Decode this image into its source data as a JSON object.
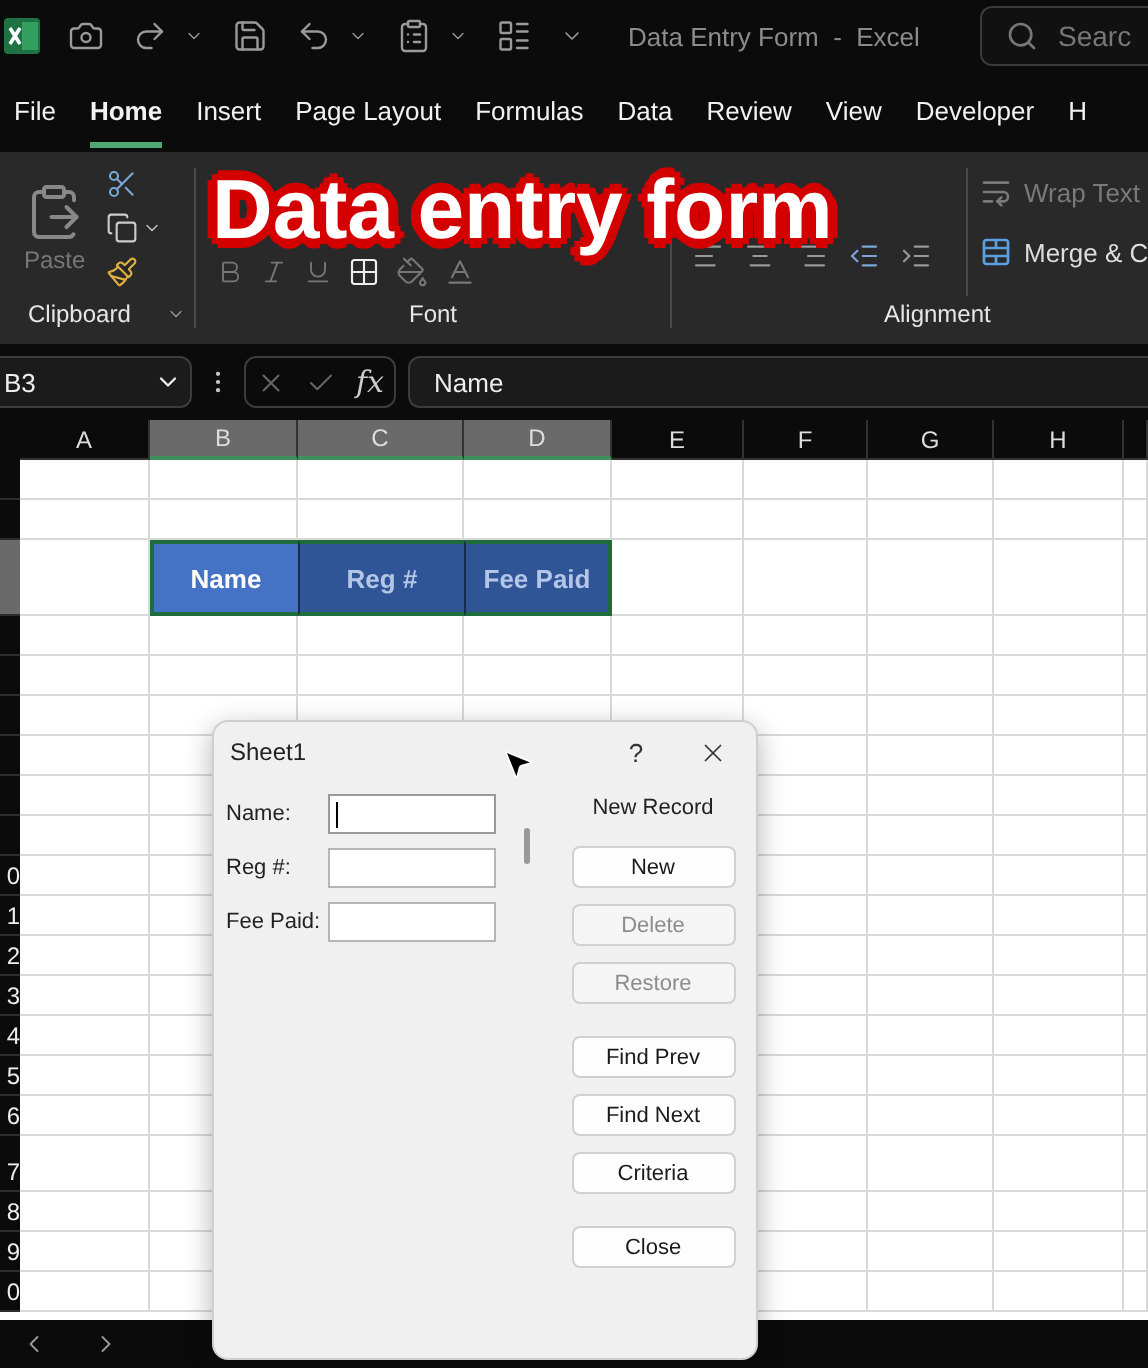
{
  "title_bar": {
    "title": "Data Entry Form  -  Excel",
    "search_placeholder": "Searc"
  },
  "menu_tabs": [
    {
      "label": "File",
      "selected": false
    },
    {
      "label": "Home",
      "selected": true
    },
    {
      "label": "Insert",
      "selected": false
    },
    {
      "label": "Page Layout",
      "selected": false
    },
    {
      "label": "Formulas",
      "selected": false
    },
    {
      "label": "Data",
      "selected": false
    },
    {
      "label": "Review",
      "selected": false
    },
    {
      "label": "View",
      "selected": false
    },
    {
      "label": "Developer",
      "selected": false
    },
    {
      "label": "H",
      "selected": false
    }
  ],
  "ribbon": {
    "paste_label": "Paste",
    "wrap_text": "Wrap Text",
    "merge": "Merge & C",
    "groups": [
      {
        "label": "Clipboard"
      },
      {
        "label": "Font"
      },
      {
        "label": "Alignment"
      }
    ]
  },
  "caption": "Data entry form",
  "formula_bar": {
    "name_box": "B3",
    "fx_label": "fx",
    "formula": "Name"
  },
  "sheet": {
    "columns": [
      {
        "label": "A",
        "selected": false
      },
      {
        "label": "B",
        "selected": true
      },
      {
        "label": "C",
        "selected": true
      },
      {
        "label": "D",
        "selected": true
      },
      {
        "label": "E",
        "selected": false
      },
      {
        "label": "F",
        "selected": false
      },
      {
        "label": "G",
        "selected": false
      },
      {
        "label": "H",
        "selected": false
      }
    ],
    "rows": [
      {
        "kind": "normal",
        "selected": false
      },
      {
        "kind": "normal",
        "selected": false
      },
      {
        "kind": "tall",
        "selected": true
      },
      {
        "kind": "normal",
        "selected": false
      },
      {
        "kind": "normal",
        "selected": false
      },
      {
        "kind": "normal",
        "selected": false
      },
      {
        "kind": "normal",
        "selected": false
      },
      {
        "kind": "normal",
        "selected": false
      },
      {
        "kind": "normal",
        "selected": false
      },
      {
        "kind": "normal",
        "selected": false,
        "label": "0"
      },
      {
        "kind": "normal",
        "selected": false,
        "label": "1"
      },
      {
        "kind": "normal",
        "selected": false,
        "label": "2"
      },
      {
        "kind": "normal",
        "selected": false,
        "label": "3"
      },
      {
        "kind": "normal",
        "selected": false,
        "label": "4"
      },
      {
        "kind": "normal",
        "selected": false,
        "label": "5"
      },
      {
        "kind": "normal",
        "selected": false,
        "label": "6"
      },
      {
        "kind": "taller",
        "selected": false,
        "label": "7"
      },
      {
        "kind": "normal",
        "selected": false,
        "label": "8"
      },
      {
        "kind": "normal",
        "selected": false,
        "label": "9"
      },
      {
        "kind": "normal",
        "selected": false,
        "label": "0"
      }
    ],
    "header_cells": [
      {
        "text": "Name",
        "active": true
      },
      {
        "text": "Reg #",
        "active": false
      },
      {
        "text": "Fee Paid",
        "active": false
      }
    ]
  },
  "dialog": {
    "title": "Sheet1",
    "help": "?",
    "record_status": "New Record",
    "fields": [
      {
        "label": "Name:",
        "focused": true
      },
      {
        "label": "Reg #:",
        "focused": false
      },
      {
        "label": "Fee Paid:",
        "focused": false
      }
    ],
    "button_groups": [
      [
        {
          "label": "New",
          "disabled": false
        },
        {
          "label": "Delete",
          "disabled": true
        },
        {
          "label": "Restore",
          "disabled": true
        }
      ],
      [
        {
          "label": "Find Prev",
          "disabled": false
        },
        {
          "label": "Find Next",
          "disabled": false
        },
        {
          "label": "Criteria",
          "disabled": false
        }
      ],
      [
        {
          "label": "Close",
          "disabled": false
        }
      ]
    ]
  }
}
